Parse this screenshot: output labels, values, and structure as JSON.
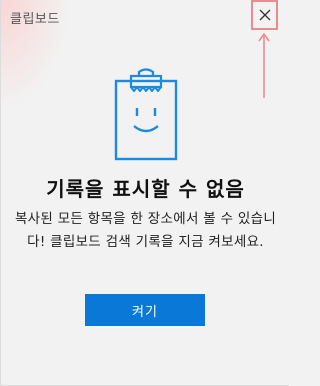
{
  "window": {
    "title": "클립보드",
    "close_icon": "close-icon"
  },
  "empty_state": {
    "illustration_icon": "clipboard-smile-icon",
    "heading": "기록을 표시할 수 없음",
    "description": "복사된 모든 항목을 한 장소에서 볼 수 있습니다! 클립보드 검색 기록을 지금 켜보세요.",
    "button_label": "켜기"
  },
  "colors": {
    "accent": "#0a78d6",
    "illustration": "#1a8be0",
    "highlight": "#ec8b8b"
  }
}
